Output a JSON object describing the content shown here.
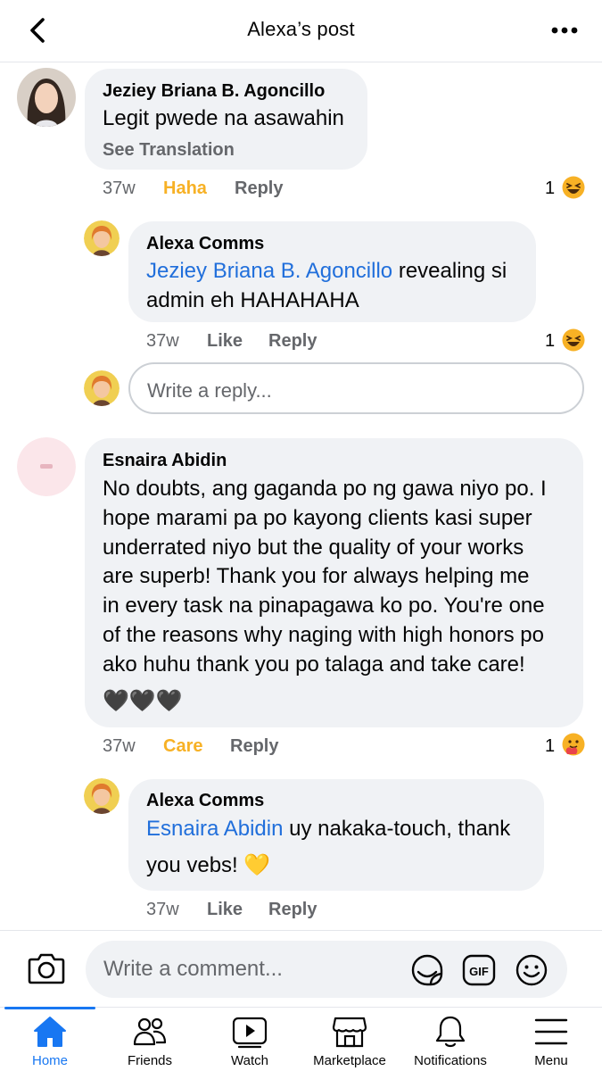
{
  "header": {
    "title": "Alexa’s post"
  },
  "comments": [
    {
      "author": "Jeziey Briana B. Agoncillo",
      "text": "Legit pwede na asawahin",
      "see_translation": "See Translation",
      "time": "37w",
      "reaction_label": "Haha",
      "reply_label": "Reply",
      "reaction_count": "1",
      "reaction_icon": "haha-emoji-icon",
      "reply": {
        "author": "Alexa Comms",
        "mention": "Jeziey Briana B. Agoncillo",
        "text_line1": " revealing si",
        "text_line2": "admin eh HAHAHAHA",
        "time": "37w",
        "like_label": "Like",
        "reply_label": "Reply",
        "reaction_count": "1",
        "reaction_icon": "haha-emoji-icon"
      },
      "reply_placeholder": "Write a reply..."
    },
    {
      "author": "Esnaira Abidin",
      "text_lines": [
        "No doubts, ang gaganda po ng gawa niyo po. I",
        "hope marami pa po kayong clients kasi super",
        "underrated niyo but the quality of your works",
        "are superb! Thank you for always helping me",
        "in every task na pinapagawa ko po. You're one",
        "of the reasons why naging with high honors po",
        "ako huhu thank you po talaga and take care!",
        "🖤🖤🖤"
      ],
      "time": "37w",
      "reaction_label": "Care",
      "reply_label": "Reply",
      "reaction_count": "1",
      "reaction_icon": "care-emoji-icon",
      "reply": {
        "author": "Alexa Comms",
        "mention": "Esnaira Abidin",
        "text_line1": " uy nakaka-touch, thank",
        "text_line2": "you vebs! 💛",
        "time": "37w",
        "like_label": "Like",
        "reply_label": "Reply"
      }
    }
  ],
  "composer": {
    "placeholder": "Write a comment..."
  },
  "tabs": [
    {
      "label": "Home",
      "icon": "home-icon",
      "active": true
    },
    {
      "label": "Friends",
      "icon": "friends-icon"
    },
    {
      "label": "Watch",
      "icon": "watch-icon"
    },
    {
      "label": "Marketplace",
      "icon": "marketplace-icon"
    },
    {
      "label": "Notifications",
      "icon": "bell-icon"
    },
    {
      "label": "Menu",
      "icon": "menu-icon"
    }
  ],
  "colors": {
    "accent": "#1877f2",
    "mention": "#216fdb",
    "reaction": "#f7b125",
    "bubble": "#f0f2f5",
    "muted": "#65676b"
  }
}
